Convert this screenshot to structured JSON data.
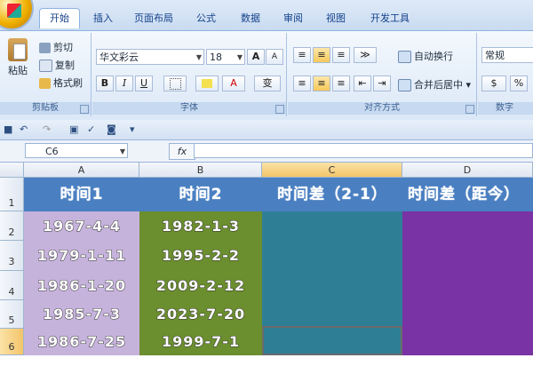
{
  "ribbon_tabs": [
    "开始",
    "插入",
    "页面布局",
    "公式",
    "数据",
    "审阅",
    "视图",
    "开发工具"
  ],
  "clipboard": {
    "paste": "粘贴",
    "cut": "剪切",
    "copy": "复制",
    "format_painter": "格式刷",
    "title": "剪贴板"
  },
  "font": {
    "name": "华文彩云",
    "size": "18",
    "grow": "A",
    "shrink": "A",
    "bold": "B",
    "italic": "I",
    "underline": "U",
    "color": "A",
    "phonetic": "变",
    "title": "字体"
  },
  "alignment": {
    "wrap": "自动换行",
    "merge": "合并后居中",
    "title": "对齐方式"
  },
  "number": {
    "format": "常规",
    "percent": "%",
    "title": "数字"
  },
  "formula_bar": {
    "name_box": "C6",
    "fx": "fx",
    "value": ""
  },
  "columns": [
    "A",
    "B",
    "C",
    "D"
  ],
  "rows": [
    "1",
    "2",
    "3",
    "4",
    "5",
    "6"
  ],
  "header_row": [
    "时间1",
    "时间2",
    "时间差（2-1）",
    "时间差（距今）"
  ],
  "time1": [
    "1967-4-4",
    "1979-1-11",
    "1986-1-20",
    "1985-7-3",
    "1986-7-25"
  ],
  "time2": [
    "1982-1-3",
    "1995-2-2",
    "2009-2-12",
    "2023-7-20",
    "1999-7-1"
  ],
  "colors": {
    "col_a": "#c6b3dc",
    "col_b": "#6b8e2e",
    "col_c": "#2e7f96",
    "col_d": "#7a33a4",
    "header": "#4a7fc1"
  }
}
